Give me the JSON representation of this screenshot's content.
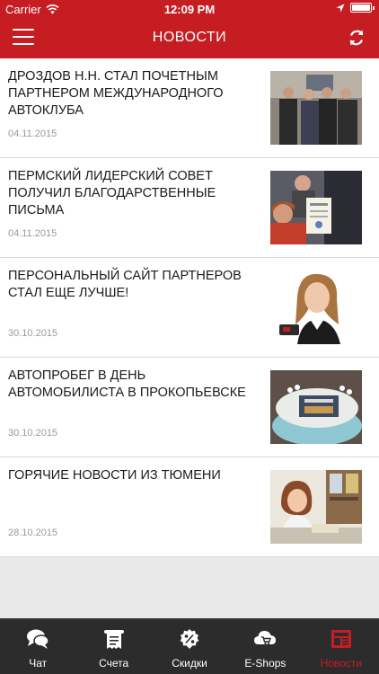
{
  "status": {
    "carrier": "Carrier",
    "time": "12:09 PM"
  },
  "header": {
    "title": "НОВОСТИ"
  },
  "news": [
    {
      "title": "ДРОЗДОВ Н.Н. СТАЛ ПОЧЕТНЫМ ПАРТНЕРОМ МЕЖДУНАРОДНОГО АВТОКЛУБА",
      "date": "04.11.2015"
    },
    {
      "title": "ПЕРМСКИЙ ЛИДЕРСКИЙ СОВЕТ ПОЛУЧИЛ БЛАГОДАРСТВЕННЫЕ ПИСЬМА",
      "date": "04.11.2015"
    },
    {
      "title": "ПЕРСОНАЛЬНЫЙ САЙТ ПАРТНЕРОВ СТАЛ ЕЩЕ ЛУЧШЕ!",
      "date": "30.10.2015"
    },
    {
      "title": "АВТОПРОБЕГ В ДЕНЬ АВТОМОБИЛИСТА В ПРОКОПЬЕВСКЕ",
      "date": "30.10.2015"
    },
    {
      "title": "ГОРЯЧИЕ НОВОСТИ ИЗ ТЮМЕНИ",
      "date": "28.10.2015"
    }
  ],
  "tabs": [
    {
      "label": "Чат",
      "icon": "chat-icon"
    },
    {
      "label": "Счета",
      "icon": "receipt-icon"
    },
    {
      "label": "Скидки",
      "icon": "discount-icon"
    },
    {
      "label": "E-Shops",
      "icon": "cloud-cart-icon"
    },
    {
      "label": "Новости",
      "icon": "news-icon",
      "active": true
    }
  ],
  "colors": {
    "accent": "#c61d23",
    "tabbar": "#2c2c2c"
  }
}
